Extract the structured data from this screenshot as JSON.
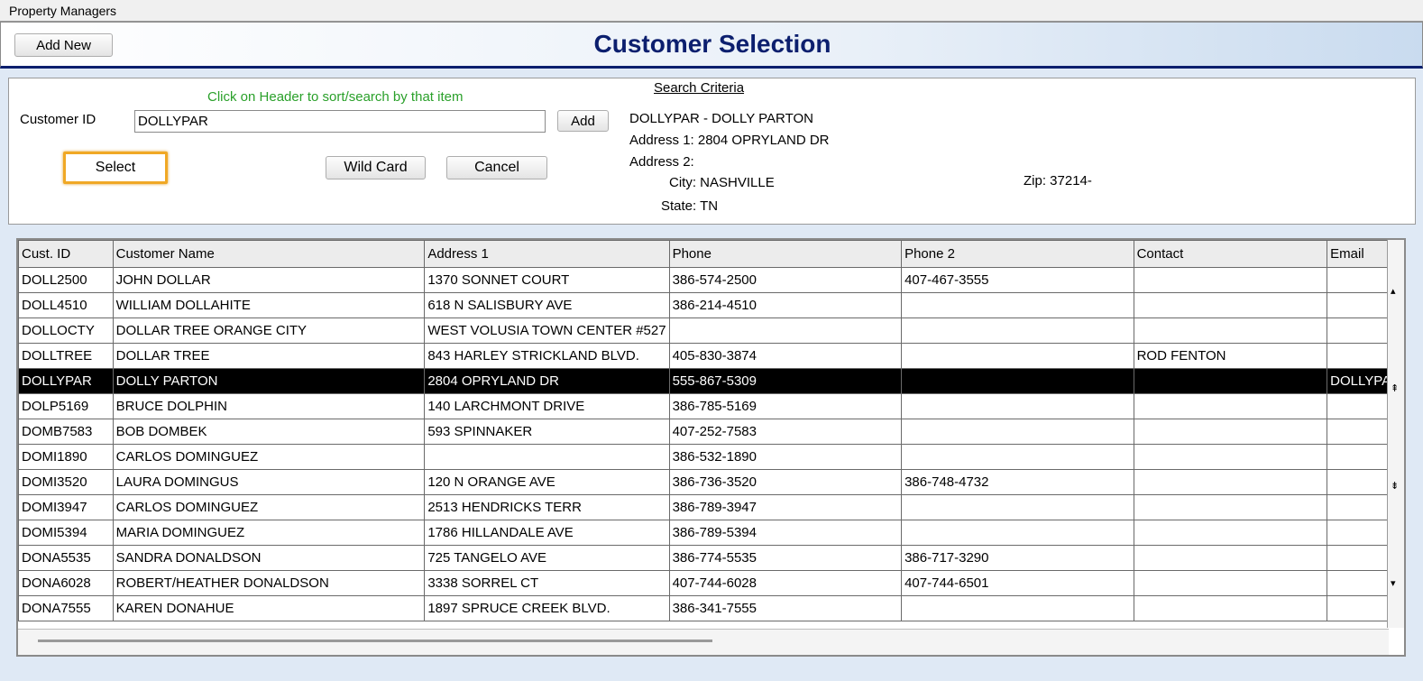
{
  "window": {
    "title": "Property Managers"
  },
  "header": {
    "add_new_label": "Add New",
    "title": "Customer Selection"
  },
  "search": {
    "hint": "Click on Header to sort/search by that item",
    "customer_id_label": "Customer ID",
    "customer_id_value": "DOLLYPAR",
    "add_label": "Add",
    "select_label": "Select",
    "wildcard_label": "Wild Card",
    "cancel_label": "Cancel"
  },
  "criteria": {
    "title": "Search Criteria",
    "heading": "DOLLYPAR - DOLLY PARTON",
    "address1": "Address 1: 2804 OPRYLAND DR",
    "address2": "Address 2:",
    "city": "City: NASHVILLE",
    "state": "State: TN",
    "zip": "Zip: 37214-"
  },
  "grid": {
    "columns": [
      "Cust. ID",
      "Customer Name",
      "Address 1",
      "Phone",
      "Phone 2",
      "Contact",
      "Email"
    ],
    "selected_row": 4,
    "rows": [
      [
        "DOLL2500",
        "JOHN DOLLAR",
        "1370 SONNET COURT",
        "386-574-2500",
        "407-467-3555",
        "",
        ""
      ],
      [
        "DOLL4510",
        "WILLIAM DOLLAHITE",
        "618 N SALISBURY AVE",
        "386-214-4510",
        "",
        "",
        ""
      ],
      [
        "DOLLOCTY",
        "DOLLAR TREE ORANGE CITY",
        "WEST VOLUSIA TOWN CENTER #527",
        "",
        "",
        "",
        ""
      ],
      [
        "DOLLTREE",
        "DOLLAR TREE",
        "843 HARLEY STRICKLAND BLVD.",
        "405-830-3874",
        "",
        "ROD FENTON",
        ""
      ],
      [
        "DOLLYPAR",
        "DOLLY PARTON",
        "2804 OPRYLAND DR",
        "555-867-5309",
        "",
        "",
        "DOLLYPAR"
      ],
      [
        "DOLP5169",
        "BRUCE DOLPHIN",
        "140 LARCHMONT DRIVE",
        "386-785-5169",
        "",
        "",
        ""
      ],
      [
        "DOMB7583",
        "BOB DOMBEK",
        "593 SPINNAKER",
        "407-252-7583",
        "",
        "",
        ""
      ],
      [
        "DOMI1890",
        "CARLOS DOMINGUEZ",
        "",
        "386-532-1890",
        "",
        "",
        ""
      ],
      [
        "DOMI3520",
        "LAURA DOMINGUS",
        "120 N ORANGE AVE",
        "386-736-3520",
        "386-748-4732",
        "",
        ""
      ],
      [
        "DOMI3947",
        "CARLOS DOMINGUEZ",
        "2513 HENDRICKS TERR",
        "386-789-3947",
        "",
        "",
        ""
      ],
      [
        "DOMI5394",
        "MARIA DOMINGUEZ",
        "1786 HILLANDALE AVE",
        "386-789-5394",
        "",
        "",
        ""
      ],
      [
        "DONA5535",
        "SANDRA DONALDSON",
        "725 TANGELO AVE",
        "386-774-5535",
        "386-717-3290",
        "",
        ""
      ],
      [
        "DONA6028",
        "ROBERT/HEATHER DONALDSON",
        "3338 SORREL CT",
        "407-744-6028",
        "407-744-6501",
        "",
        ""
      ],
      [
        "DONA7555",
        "KAREN DONAHUE",
        "1897 SPRUCE CREEK BLVD.",
        "386-341-7555",
        "",
        "",
        ""
      ]
    ]
  },
  "scrollbar": {
    "up_icon": "▴",
    "page_up_icon": "⇞",
    "page_down_icon": "⇟",
    "down_icon": "▾"
  }
}
